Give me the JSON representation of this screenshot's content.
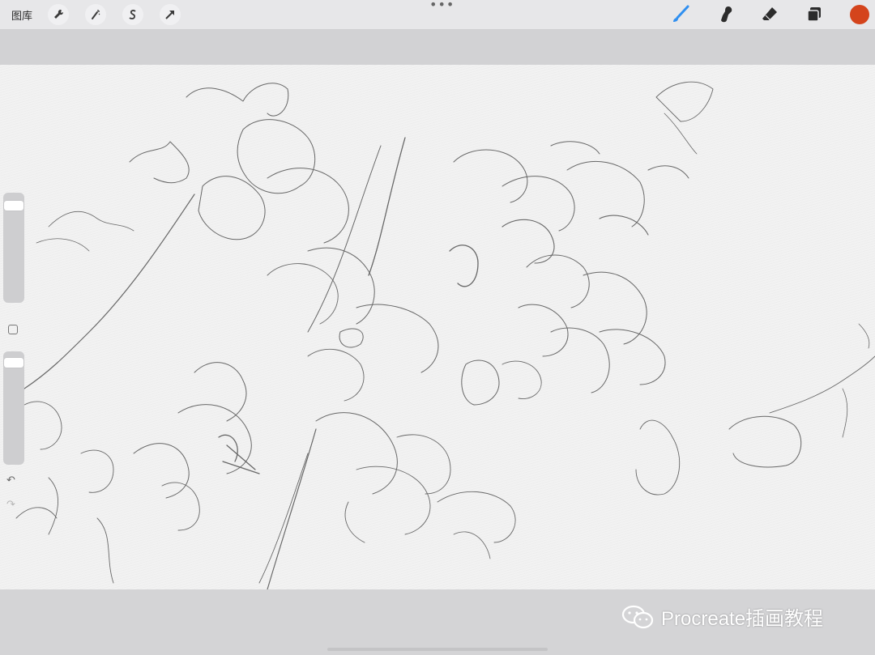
{
  "toolbar": {
    "gallery_label": "图库",
    "left_tools": [
      {
        "name": "actions",
        "icon": "wrench-icon"
      },
      {
        "name": "adjustments",
        "icon": "magic-wand-icon"
      },
      {
        "name": "selection",
        "icon": "selection-s-icon"
      },
      {
        "name": "transform",
        "icon": "arrow-cursor-icon"
      }
    ],
    "more_glyph": "•••",
    "right_tools": [
      {
        "name": "brush",
        "icon": "brush-icon",
        "active": true
      },
      {
        "name": "smudge",
        "icon": "smudge-icon"
      },
      {
        "name": "eraser",
        "icon": "eraser-icon"
      },
      {
        "name": "layers",
        "icon": "layers-icon"
      }
    ],
    "current_color": "#d4441c"
  },
  "sidebar": {
    "undo_glyph": "↶",
    "redo_glyph": "↷"
  },
  "watermark": {
    "text": "Procreate插画教程"
  },
  "colors": {
    "accent": "#2f8ff0",
    "canvas": "#f2f2f2",
    "pencil": "#3a3a3a"
  }
}
